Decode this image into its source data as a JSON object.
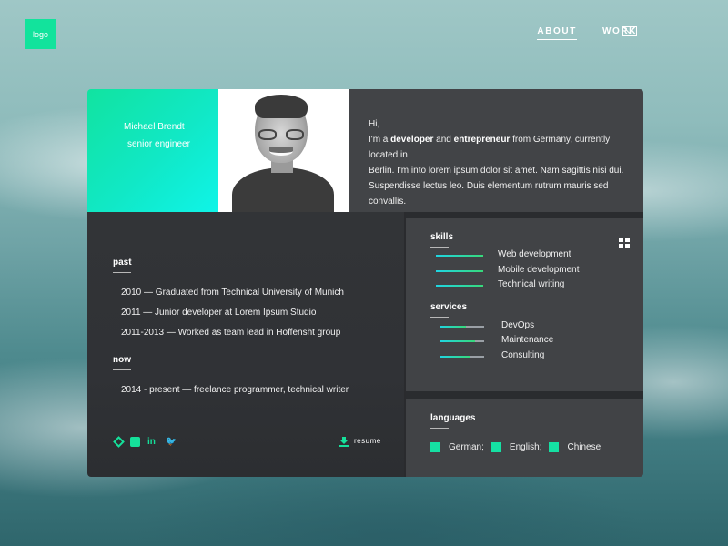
{
  "header": {
    "logo": "logo",
    "nav": [
      {
        "label": "ABOUT",
        "active": true
      },
      {
        "label": "WORK",
        "active": false
      }
    ],
    "mail_icon": "envelope-icon"
  },
  "profile": {
    "name": "Michael Brendt",
    "title": "senior engineer",
    "bio": {
      "greeting": "Hi,",
      "p1": "I'm a ",
      "developer": "developer",
      "and": " and ",
      "entrepreneur": "entrepreneur",
      "rest1": " from Germany, currently located in",
      "line2": "Berlin. I'm into lorem ipsum dolor sit amet. Nam sagittis nisi dui.",
      "line3": "Suspendisse lectus leo. Duis elementum rutrum mauris sed convallis."
    }
  },
  "timeline": {
    "past_label": "past",
    "past": [
      "2010 — Graduated from Technical University of Munich",
      "2011 — Junior developer at Lorem Ipsum Studio",
      "2011-2013 — Worked as team lead in Hoffensht group"
    ],
    "now_label": "now",
    "now": [
      "2014 - present — freelance programmer, technical writer"
    ]
  },
  "socials": [
    "codepen-icon",
    "github-icon",
    "linkedin-icon",
    "twitter-icon"
  ],
  "resume_label": "resume",
  "skills": {
    "label": "skills",
    "items": [
      {
        "label": "Web development",
        "level": 1.0
      },
      {
        "label": "Mobile development",
        "level": 1.0
      },
      {
        "label": "Technical writing",
        "level": 1.0
      }
    ]
  },
  "services": {
    "label": "services",
    "items": [
      {
        "label": "DevOps",
        "level": 0.6
      },
      {
        "label": "Maintenance",
        "level": 0.8
      },
      {
        "label": "Consulting",
        "level": 0.7
      }
    ]
  },
  "languages": {
    "label": "languages",
    "items": [
      "German;",
      "English;",
      "Chinese"
    ]
  },
  "colors": {
    "accent": "#15e09a",
    "panel_dark": "#323437",
    "panel_mid": "#414346"
  }
}
